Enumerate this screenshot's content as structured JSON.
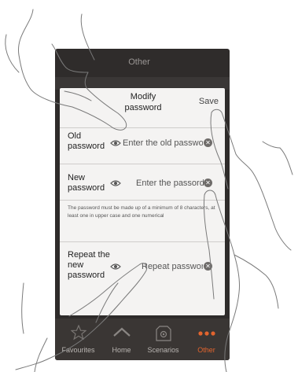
{
  "app": {
    "title": "Other"
  },
  "dialog": {
    "title": "Modify\npassword",
    "save_label": "Save",
    "fields": [
      {
        "label": "Old\npassword",
        "placeholder": "Enter the old passwo"
      },
      {
        "label": "New\npassword",
        "placeholder": "Enter the passord"
      },
      {
        "label": "Repeat the\nnew\npassword",
        "placeholder": "Repeat passwor"
      }
    ],
    "hint": "The password must be made up of a minimum of 8 characters, at least one in upper case and one numerical"
  },
  "nav": {
    "items": [
      {
        "label": "Favourites",
        "icon": "star-icon",
        "active": false
      },
      {
        "label": "Home",
        "icon": "home-icon",
        "active": false
      },
      {
        "label": "Scenarios",
        "icon": "scenarios-icon",
        "active": false
      },
      {
        "label": "Other",
        "icon": "more-icon",
        "active": true
      }
    ]
  },
  "colors": {
    "accent": "#e2642e",
    "dialog_bg": "#f4f3f2",
    "app_bg": "#2f2c2b"
  }
}
